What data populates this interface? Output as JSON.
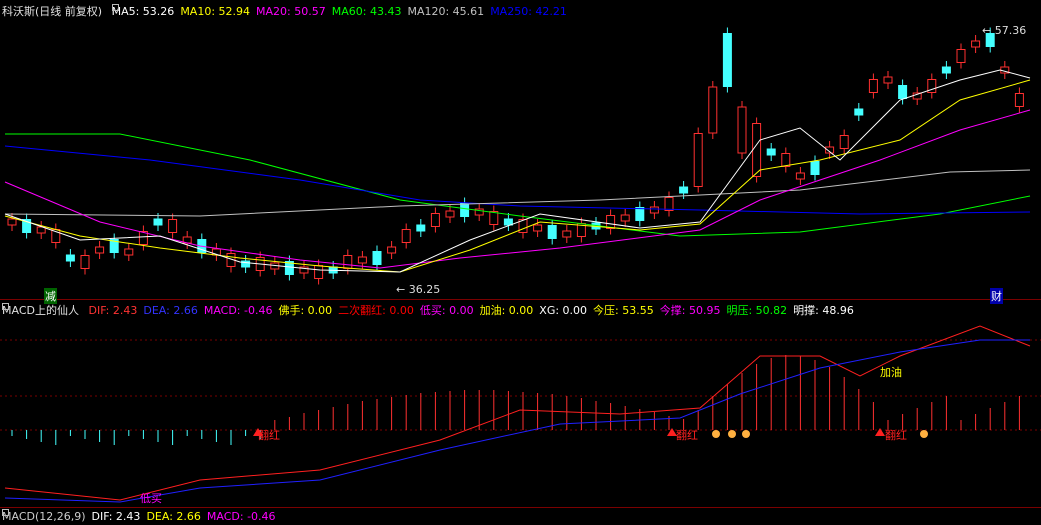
{
  "main_panel": {
    "title": "科沃斯(日线 前复权)",
    "ma_labels": [
      {
        "text": "MA5: 53.26",
        "color": "#ffffff"
      },
      {
        "text": "MA10: 52.94",
        "color": "#ffff00"
      },
      {
        "text": "MA20: 50.57",
        "color": "#ff00ff"
      },
      {
        "text": "MA60: 43.43",
        "color": "#00ff00"
      },
      {
        "text": "MA120: 45.61",
        "color": "#c0c0c0"
      },
      {
        "text": "MA250: 42.21",
        "color": "#0000ff"
      }
    ],
    "high_label": "57.36",
    "low_label": "36.25",
    "tag_left": "减",
    "tag_right": "财"
  },
  "indicator_panel": {
    "title": "MACD上的仙人",
    "fields": [
      {
        "text": "DIF: 2.43",
        "color": "#ff3333"
      },
      {
        "text": "DEA: 2.66",
        "color": "#3333ff"
      },
      {
        "text": "MACD: -0.46",
        "color": "#ff00ff"
      },
      {
        "text": "佛手: 0.00",
        "color": "#ffff00"
      },
      {
        "text": "二次翻红: 0.00",
        "color": "#ff0000"
      },
      {
        "text": "低买: 0.00",
        "color": "#ff00ff"
      },
      {
        "text": "加油: 0.00",
        "color": "#ffff00"
      },
      {
        "text": "XG: 0.00",
        "color": "#ffffff"
      },
      {
        "text": "今压: 53.55",
        "color": "#ffff00"
      },
      {
        "text": "今撑: 50.95",
        "color": "#ff00ff"
      },
      {
        "text": "明压: 50.82",
        "color": "#00ff00"
      },
      {
        "text": "明撑: 48.96",
        "color": "#ffffff"
      }
    ],
    "annotations": {
      "fanhong": "翻红",
      "jiayou": "加油",
      "dimai": "低买"
    }
  },
  "bottom_panel": {
    "fields": [
      {
        "text": "MACD(12,26,9)",
        "color": "#cccccc"
      },
      {
        "text": "DIF: 2.43",
        "color": "#ffffff"
      },
      {
        "text": "DEA: 2.66",
        "color": "#ffff00"
      },
      {
        "text": "MACD: -0.46",
        "color": "#ff00ff"
      }
    ]
  }
}
